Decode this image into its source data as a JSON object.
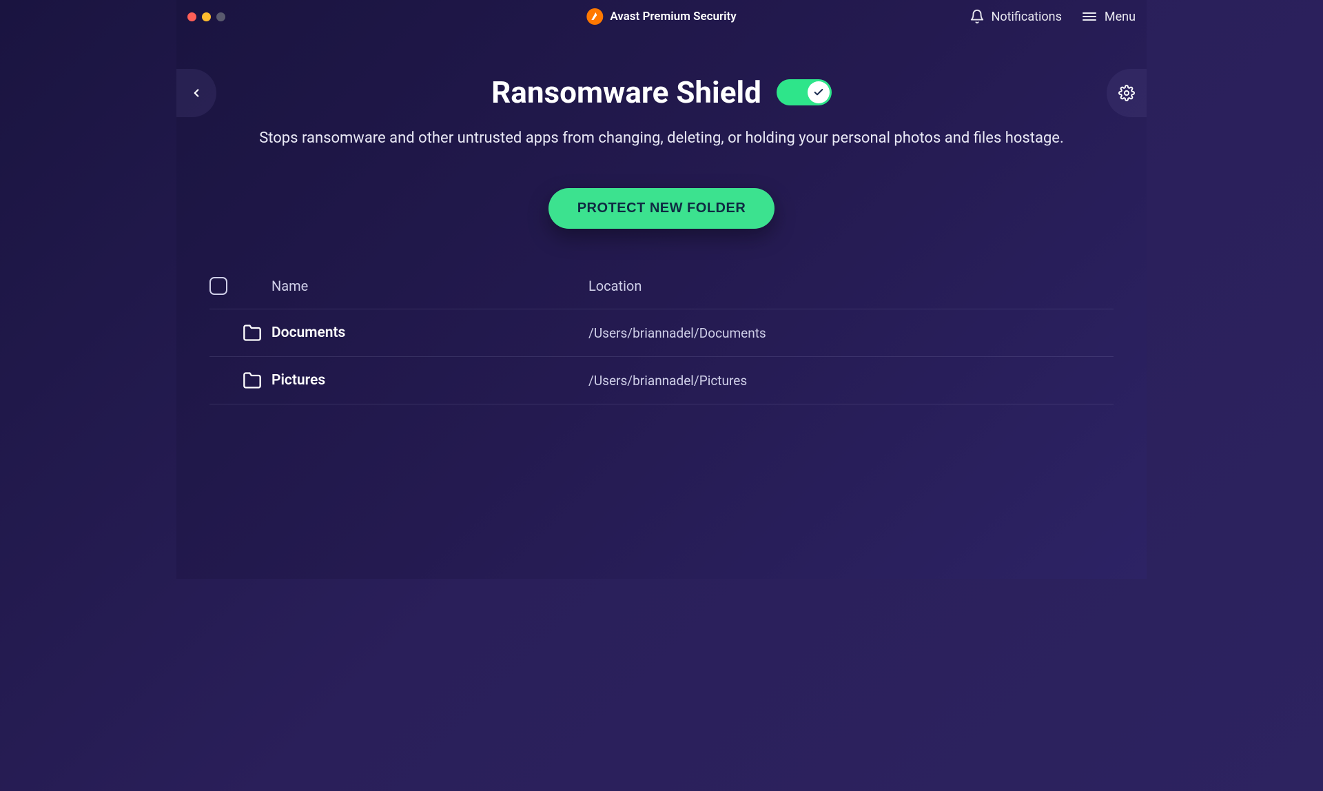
{
  "app": {
    "title": "Avast Premium Security"
  },
  "topbar": {
    "notifications_label": "Notifications",
    "menu_label": "Menu"
  },
  "page": {
    "title": "Ransomware Shield",
    "description": "Stops ransomware and other untrusted apps from changing, deleting, or holding your personal photos and files hostage.",
    "primary_button": "PROTECT NEW FOLDER",
    "toggle_on": true
  },
  "table": {
    "headers": {
      "name": "Name",
      "location": "Location"
    },
    "rows": [
      {
        "name": "Documents",
        "location": "/Users/briannadel/Documents"
      },
      {
        "name": "Pictures",
        "location": "/Users/briannadel/Pictures"
      }
    ]
  },
  "colors": {
    "accent_green": "#3ce28f",
    "brand_orange": "#ff7800"
  }
}
